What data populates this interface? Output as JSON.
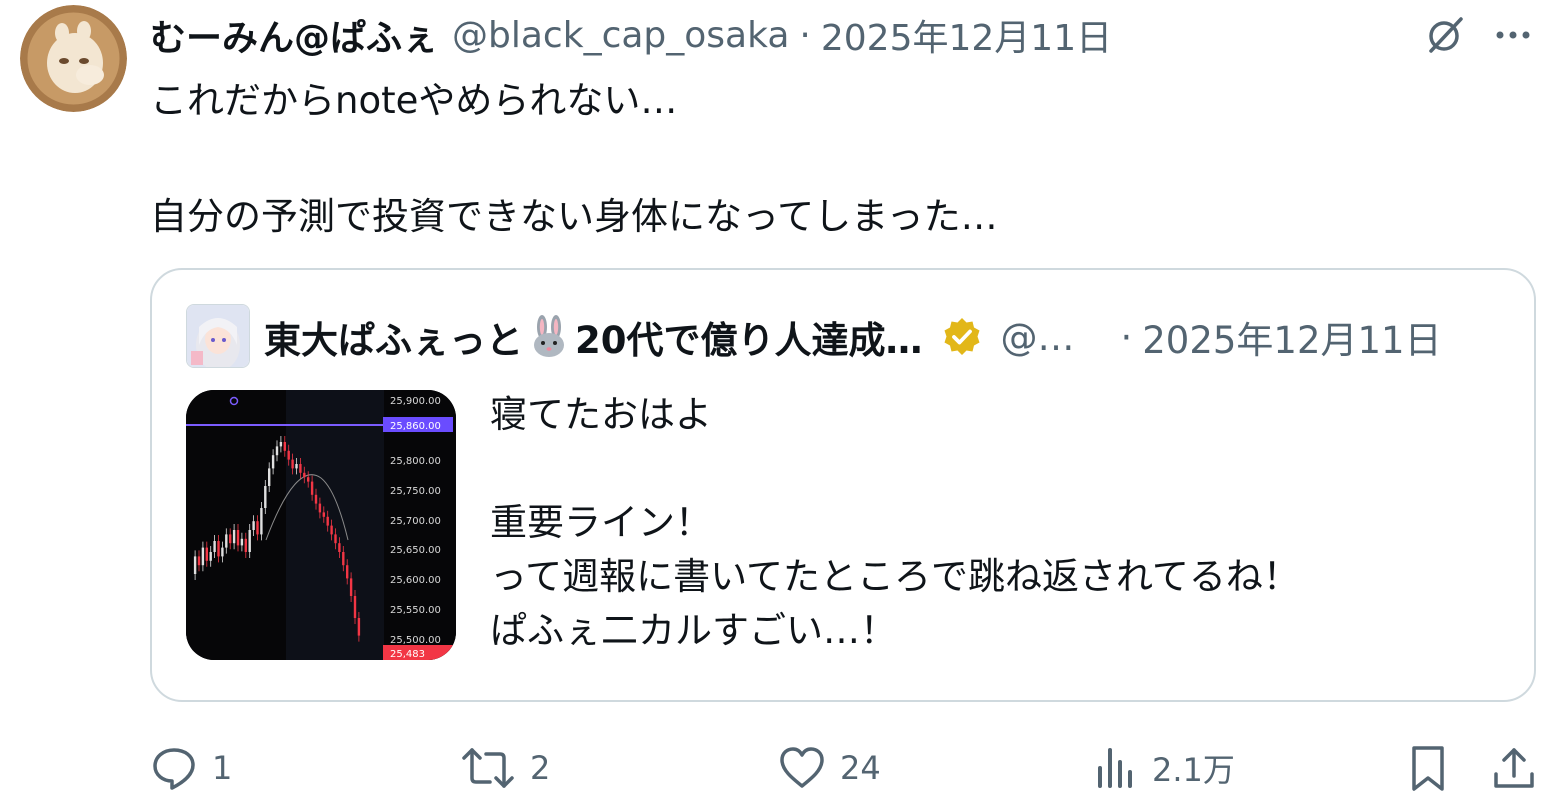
{
  "tweet": {
    "display_name": "むーみん@ぱふぇ",
    "handle": "@black_cap_osaka",
    "separator": "·",
    "date": "2025年12月11日",
    "text": "これだからnoteやめられない…\n\n自分の予測で投資できない身体になってしまった…",
    "avatar_icon": "latte-art-moomin-avatar"
  },
  "top_icons": [
    "grok-slash-icon",
    "more-icon"
  ],
  "quote": {
    "display_name_prefix": "東大ぱふぇっと",
    "display_name_emoji": "rabbit-face-emoji",
    "display_name_suffix": "20代で億り人達成…",
    "verified_badge": "gold-verified-badge",
    "handle": "@…",
    "separator": "·",
    "date": "2025年12月11日",
    "text": "寝てたおはよ\n\n重要ライン！\nって週報に書いてたところで跳ね返されてるね！\nぱふぇ二カルすごい…！",
    "chart_thumbnail": {
      "price_labels": [
        "25,900.00",
        "25,860.00",
        "25,800.00",
        "25,750.00",
        "25,700.00",
        "25,650.00",
        "25,600.00",
        "25,550.00",
        "25,500.00",
        "25,483"
      ],
      "line_color": "#7b5cff",
      "down_color": "#f23645",
      "up_color": "#e0e0e0"
    }
  },
  "actions": {
    "reply_count": "1",
    "retweet_count": "2",
    "like_count": "24",
    "views_count": "2.1万"
  },
  "colors": {
    "text_primary": "#0f1419",
    "text_secondary": "#536471",
    "border": "#cfd9de"
  }
}
